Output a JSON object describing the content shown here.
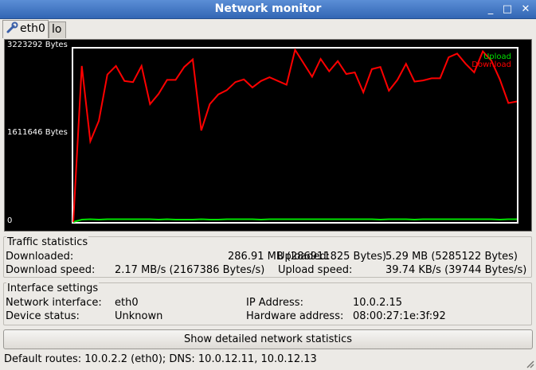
{
  "window": {
    "title": "Network monitor",
    "controls": {
      "minimize": "_",
      "maximize": "□",
      "close": "✕"
    }
  },
  "tabs": [
    {
      "label": "eth0",
      "icon": "wrench-icon",
      "active": true
    },
    {
      "label": "lo",
      "active": false
    }
  ],
  "graph": {
    "y_top_label": "3223292 Bytes",
    "y_mid_label": "1611646 Bytes",
    "y_zero_label": "0",
    "legend": {
      "upload": "Upload",
      "download": "Download"
    },
    "colors": {
      "upload": "#00e000",
      "download": "#ff0000",
      "background": "#000000",
      "frame": "#ffffff"
    }
  },
  "chart_data": {
    "type": "line",
    "ylim": [
      0,
      3223292
    ],
    "y_tick_labels": [
      "0",
      "1611646 Bytes",
      "3223292 Bytes"
    ],
    "legend_placement": "top-right",
    "series": [
      {
        "name": "Upload",
        "color": "#00e000",
        "values": [
          0,
          45000,
          52000,
          45000,
          52000,
          52000,
          52000,
          52000,
          52000,
          52000,
          45000,
          52000,
          45000,
          45000,
          45000,
          52000,
          45000,
          45000,
          52000,
          52000,
          52000,
          52000,
          45000,
          52000,
          52000,
          52000,
          52000,
          52000,
          52000,
          52000,
          52000,
          52000,
          52000,
          52000,
          52000,
          52000,
          45000,
          52000,
          52000,
          52000,
          45000,
          52000,
          52000,
          52000,
          52000,
          52000,
          52000,
          52000,
          52000,
          52000,
          45000,
          52000,
          52000
        ]
      },
      {
        "name": "Download",
        "color": "#ff0000",
        "values": [
          0,
          2900000,
          1500000,
          1880000,
          2740000,
          2900000,
          2620000,
          2600000,
          2900000,
          2190000,
          2380000,
          2640000,
          2640000,
          2880000,
          3020000,
          1700000,
          2190000,
          2370000,
          2450000,
          2600000,
          2650000,
          2500000,
          2620000,
          2690000,
          2620000,
          2550000,
          3200000,
          2950000,
          2700000,
          3030000,
          2800000,
          2990000,
          2750000,
          2780000,
          2410000,
          2840000,
          2880000,
          2440000,
          2640000,
          2940000,
          2610000,
          2630000,
          2670000,
          2670000,
          3060000,
          3130000,
          2940000,
          2780000,
          3170000,
          3000000,
          2650000,
          2210000,
          2240000
        ]
      }
    ]
  },
  "traffic": {
    "title": "Traffic statistics",
    "downloaded_label": "Downloaded:",
    "downloaded_value": "286.91 MB (286911825 Bytes)",
    "uploaded_label": "Uploaded:",
    "uploaded_value": "5.29 MB (5285122 Bytes)",
    "download_speed_label": "Download speed:",
    "download_speed_value": "2.17 MB/s (2167386 Bytes/s)",
    "upload_speed_label": "Upload speed:",
    "upload_speed_value": "39.74 KB/s (39744 Bytes/s)"
  },
  "interface": {
    "title": "Interface settings",
    "network_interface_label": "Network interface:",
    "network_interface_value": "eth0",
    "ip_label": "IP Address:",
    "ip_value": "10.0.2.15",
    "device_status_label": "Device status:",
    "device_status_value": "Unknown",
    "hw_label": "Hardware address:",
    "hw_value": "08:00:27:1e:3f:92"
  },
  "details_button": "Show detailed network statistics",
  "status_bar": "Default routes: 10.0.2.2 (eth0); DNS: 10.0.12.11, 10.0.12.13"
}
